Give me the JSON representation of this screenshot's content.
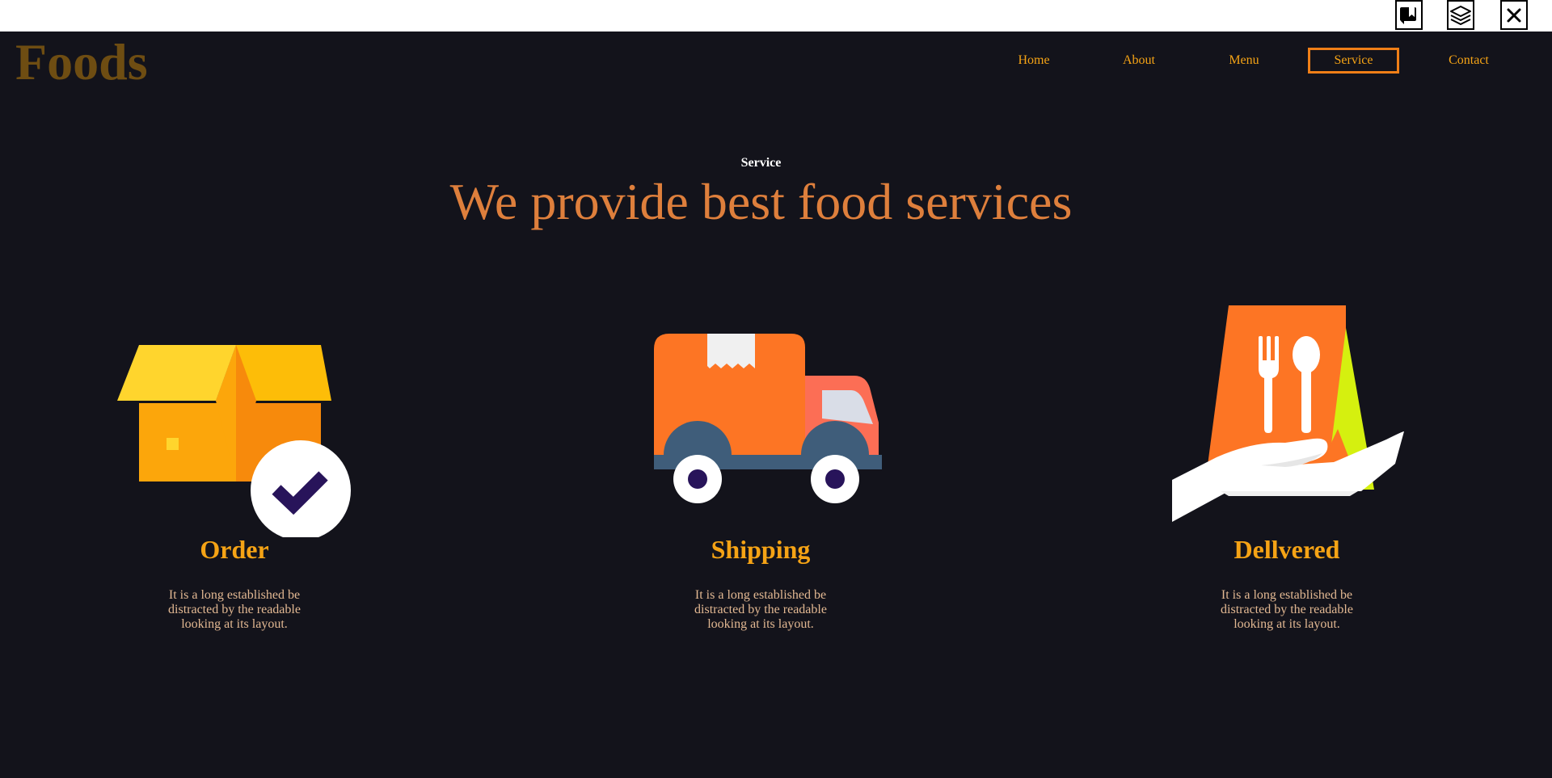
{
  "toolbar": {
    "icons": [
      "bookmark-reader-icon",
      "layers-icon",
      "close-icon"
    ]
  },
  "brand": {
    "logo": "Foods"
  },
  "nav": {
    "items": [
      {
        "label": "Home"
      },
      {
        "label": "About"
      },
      {
        "label": "Menu"
      },
      {
        "label": "Service",
        "active": true
      },
      {
        "label": "Contact"
      }
    ]
  },
  "section": {
    "eyebrow": "Service",
    "headline": "We provide best food services"
  },
  "services": [
    {
      "title": "Order",
      "text": "It is a long established be distracted by the readable looking at its layout.",
      "icon": "box-checked-icon"
    },
    {
      "title": "Shipping",
      "text": "It is a long established be distracted by the readable looking at its layout.",
      "icon": "delivery-truck-icon"
    },
    {
      "title": "Dellvered",
      "text": "It is a long established be distracted by the readable looking at its layout.",
      "icon": "food-bag-hand-icon"
    }
  ],
  "colors": {
    "background": "#13131b",
    "accent": "#f5a315",
    "headline": "#de7f3c",
    "logo": "#6e4d12",
    "active_border": "#f07f17",
    "body_text": "#e2b892"
  }
}
